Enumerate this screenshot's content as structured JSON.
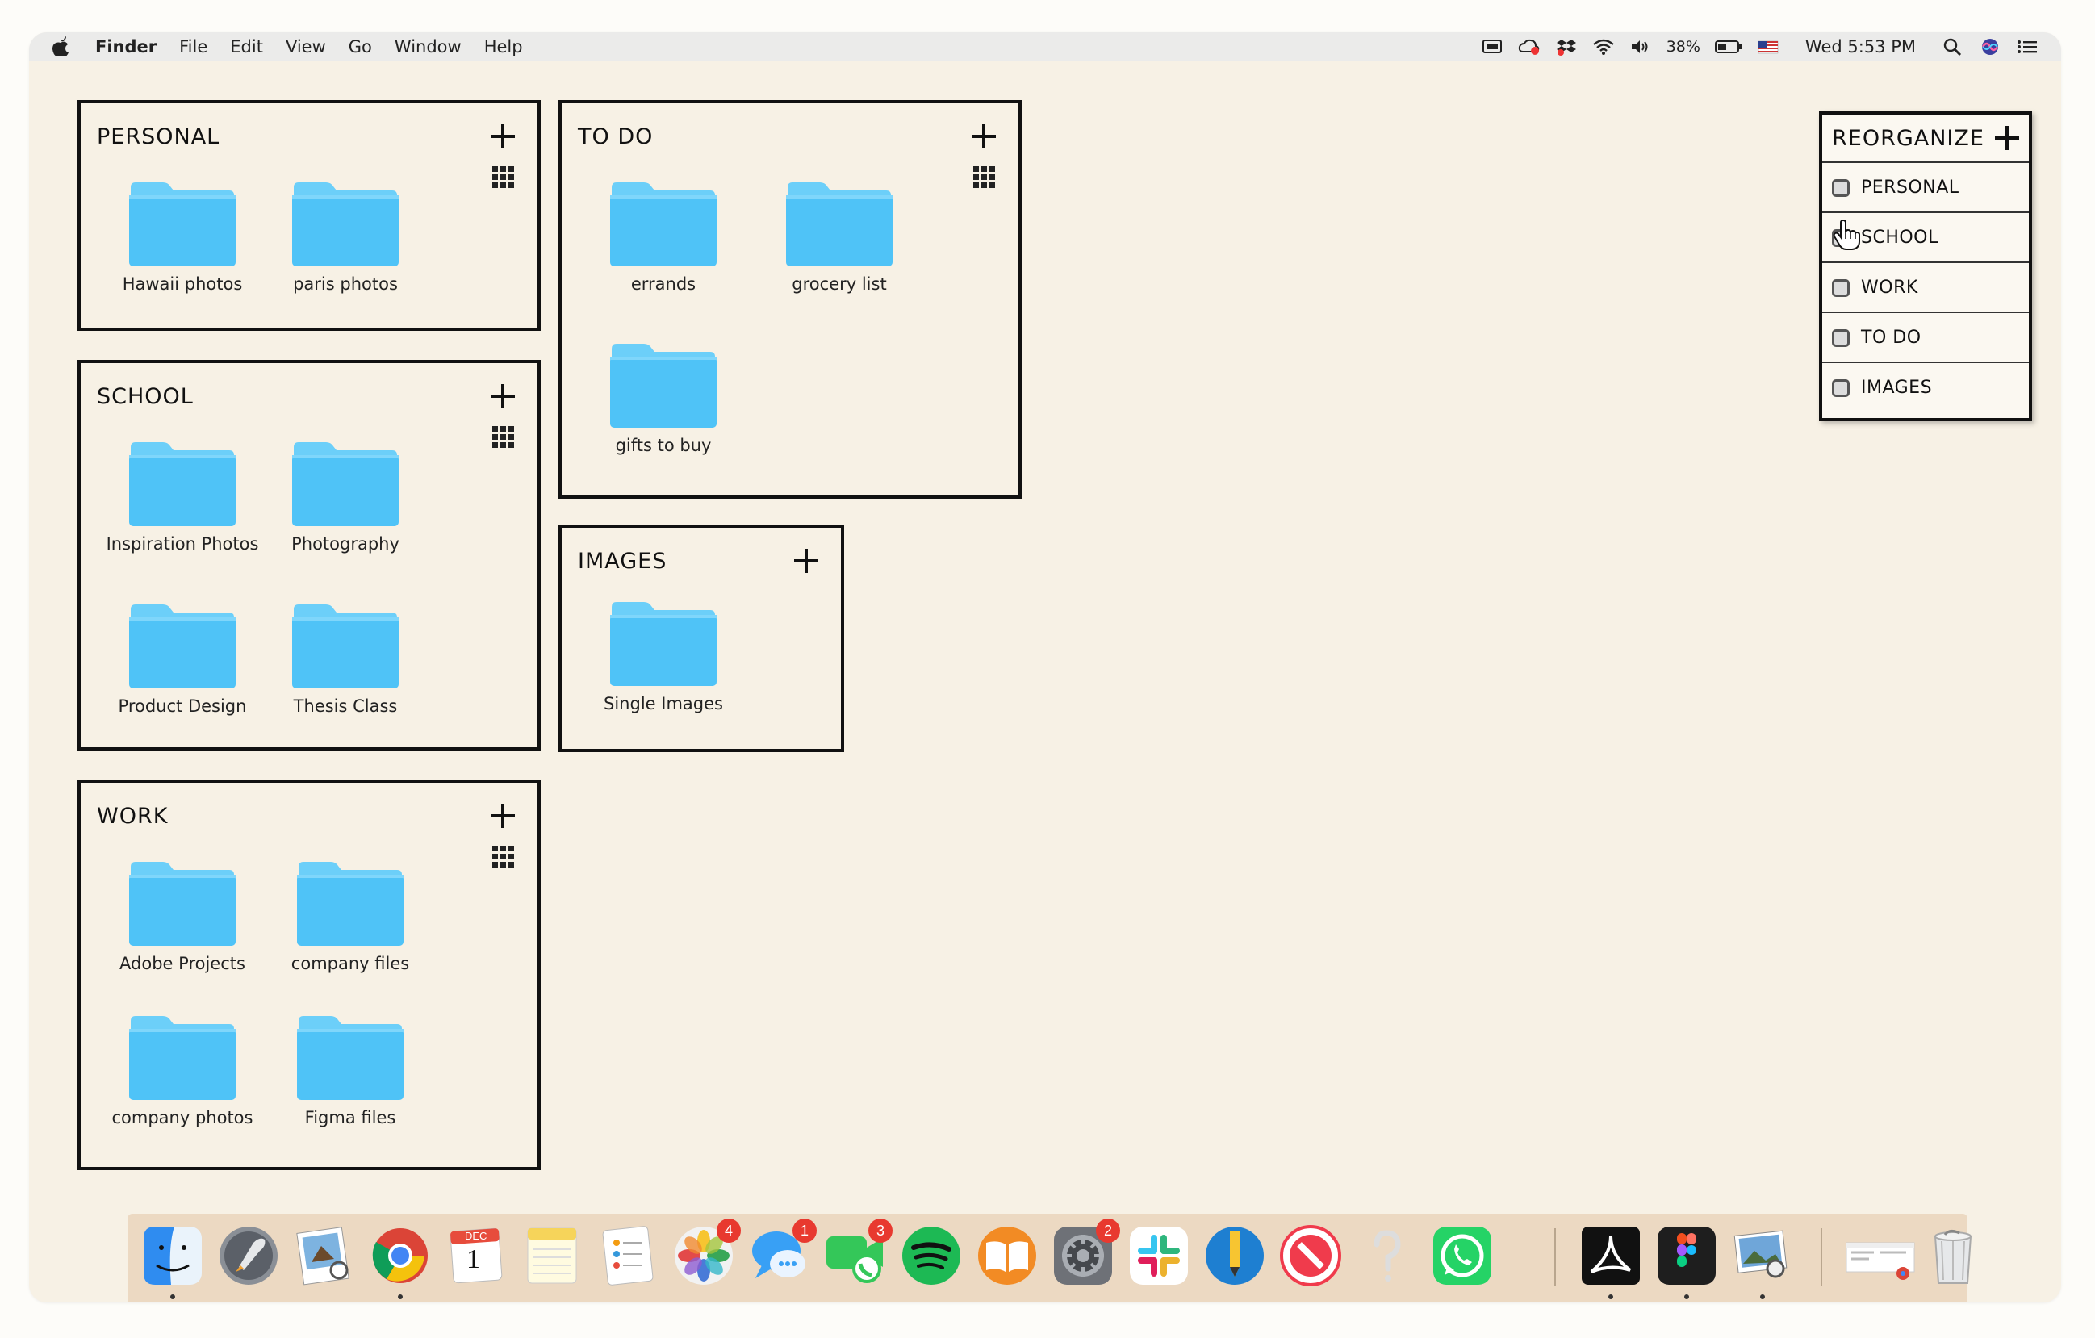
{
  "menubar": {
    "app_name": "Finder",
    "menus": [
      "File",
      "Edit",
      "View",
      "Go",
      "Window",
      "Help"
    ],
    "battery_percent": "38%",
    "clock": "Wed 5:53 PM"
  },
  "panels": {
    "personal": {
      "title": "PERSONAL",
      "folders": [
        "Hawaii photos",
        "paris photos"
      ]
    },
    "school": {
      "title": "SCHOOL",
      "folders": [
        "Inspiration Photos",
        "Photography",
        "Product Design",
        "Thesis Class"
      ]
    },
    "work": {
      "title": "WORK",
      "folders": [
        "Adobe Projects",
        "company files",
        "company photos",
        "Figma files"
      ]
    },
    "todo": {
      "title": "TO DO",
      "folders": [
        "errands",
        "grocery list",
        "gifts to buy"
      ]
    },
    "images": {
      "title": "IMAGES",
      "folders": [
        "Single Images"
      ]
    }
  },
  "reorganize": {
    "title": "REORGANIZE",
    "items": [
      "PERSONAL",
      "SCHOOL",
      "WORK",
      "TO DO",
      "IMAGES"
    ]
  },
  "dock": {
    "badges": {
      "photos": "4",
      "messages": "1",
      "facetime": "3",
      "settings": "2"
    },
    "calendar_month": "DEC",
    "calendar_day": "1"
  },
  "colors": {
    "folder": "#5ac8fa",
    "folder_tab": "#6dd0fb",
    "accent_badge": "#e8392f"
  }
}
